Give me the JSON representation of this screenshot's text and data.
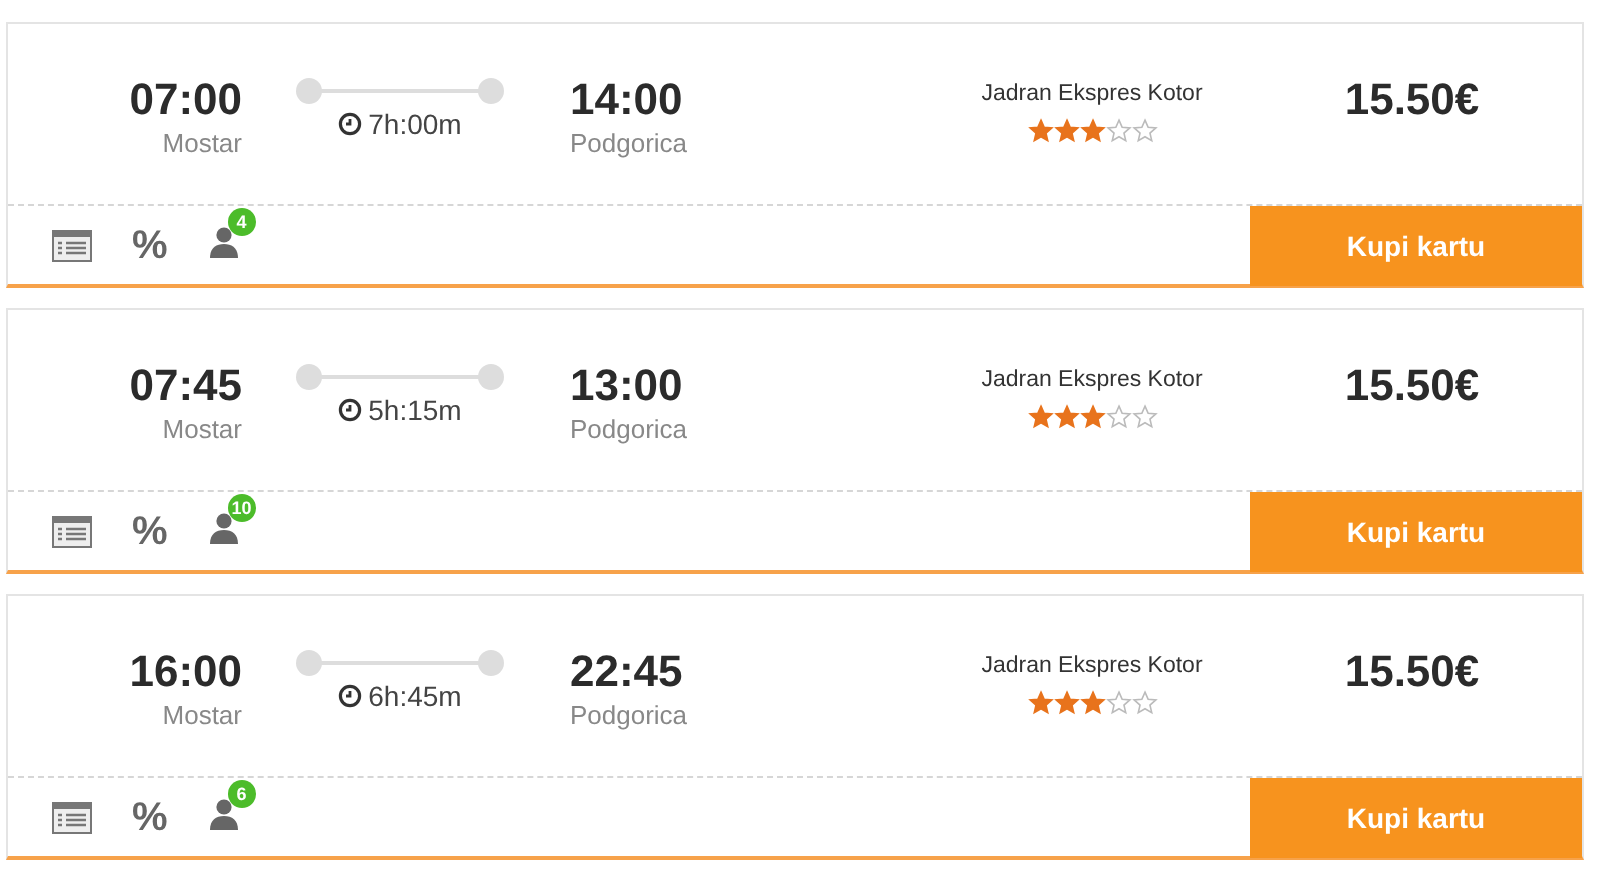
{
  "trips": [
    {
      "departure_time": "07:00",
      "departure_city": "Mostar",
      "duration": "7h:00m",
      "arrival_time": "14:00",
      "arrival_city": "Podgorica",
      "operator": "Jadran Ekspres Kotor",
      "stars": 3,
      "price": "15.50€",
      "discount": "%",
      "seats": "4",
      "button": "Kupi kartu"
    },
    {
      "departure_time": "07:45",
      "departure_city": "Mostar",
      "duration": "5h:15m",
      "arrival_time": "13:00",
      "arrival_city": "Podgorica",
      "operator": "Jadran Ekspres Kotor",
      "stars": 3,
      "price": "15.50€",
      "discount": "%",
      "seats": "10",
      "button": "Kupi kartu"
    },
    {
      "departure_time": "16:00",
      "departure_city": "Mostar",
      "duration": "6h:45m",
      "arrival_time": "22:45",
      "arrival_city": "Podgorica",
      "operator": "Jadran Ekspres Kotor",
      "stars": 3,
      "price": "15.50€",
      "discount": "%",
      "seats": "6",
      "button": "Kupi kartu"
    }
  ]
}
